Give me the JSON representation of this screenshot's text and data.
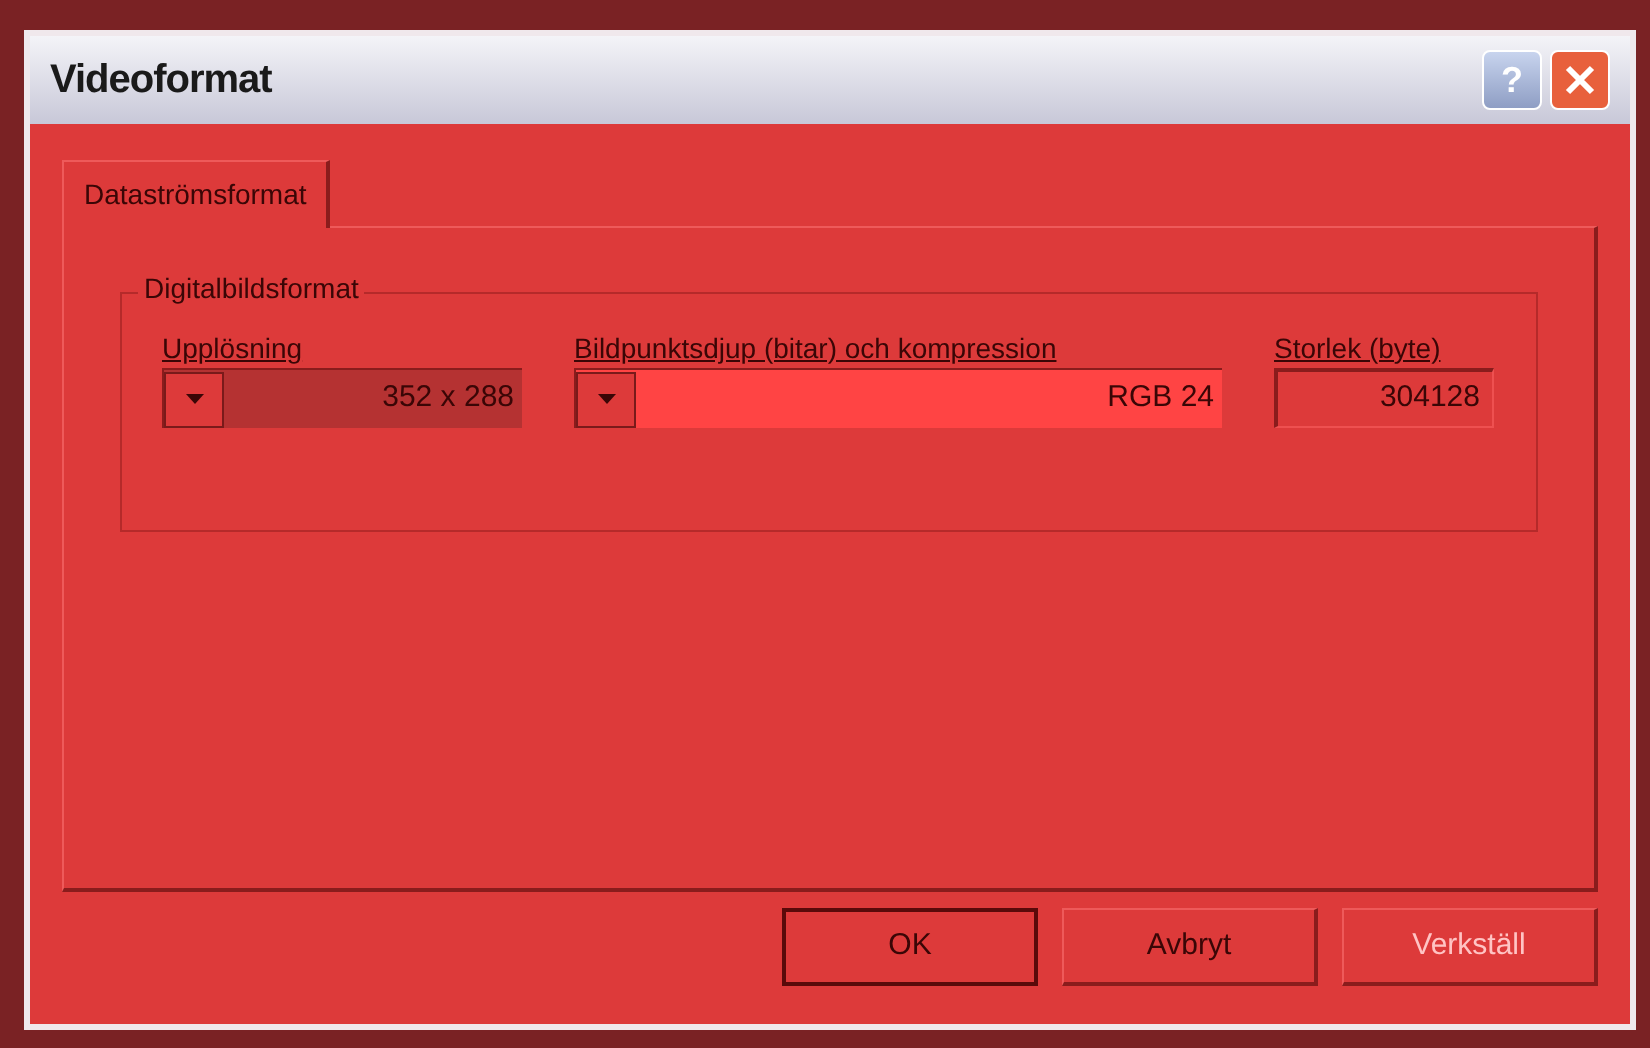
{
  "window": {
    "title": "Videoformat",
    "title_buttons": [
      "?"
    ]
  },
  "tabs": [
    {
      "label": "Dataströmsformat",
      "selected": true
    }
  ],
  "group": {
    "title": "Digitalbildsformat",
    "fields": [
      {
        "kind": "dropdown",
        "label": "Upplösning",
        "value": "352 x 288",
        "disabled": true
      },
      {
        "kind": "dropdown",
        "label": "Bildpunktsdjup (bitar) och kompression",
        "value": "RGB 24",
        "disabled": false
      },
      {
        "kind": "text",
        "label": "Storlek (byte)",
        "value": "304128",
        "disabled": false
      }
    ]
  },
  "buttons": [
    {
      "label": "OK",
      "default": true,
      "disabled": false
    },
    {
      "label": "Avbryt",
      "default": false,
      "disabled": false
    },
    {
      "label": "Verkställ",
      "default": false,
      "disabled": true
    }
  ]
}
